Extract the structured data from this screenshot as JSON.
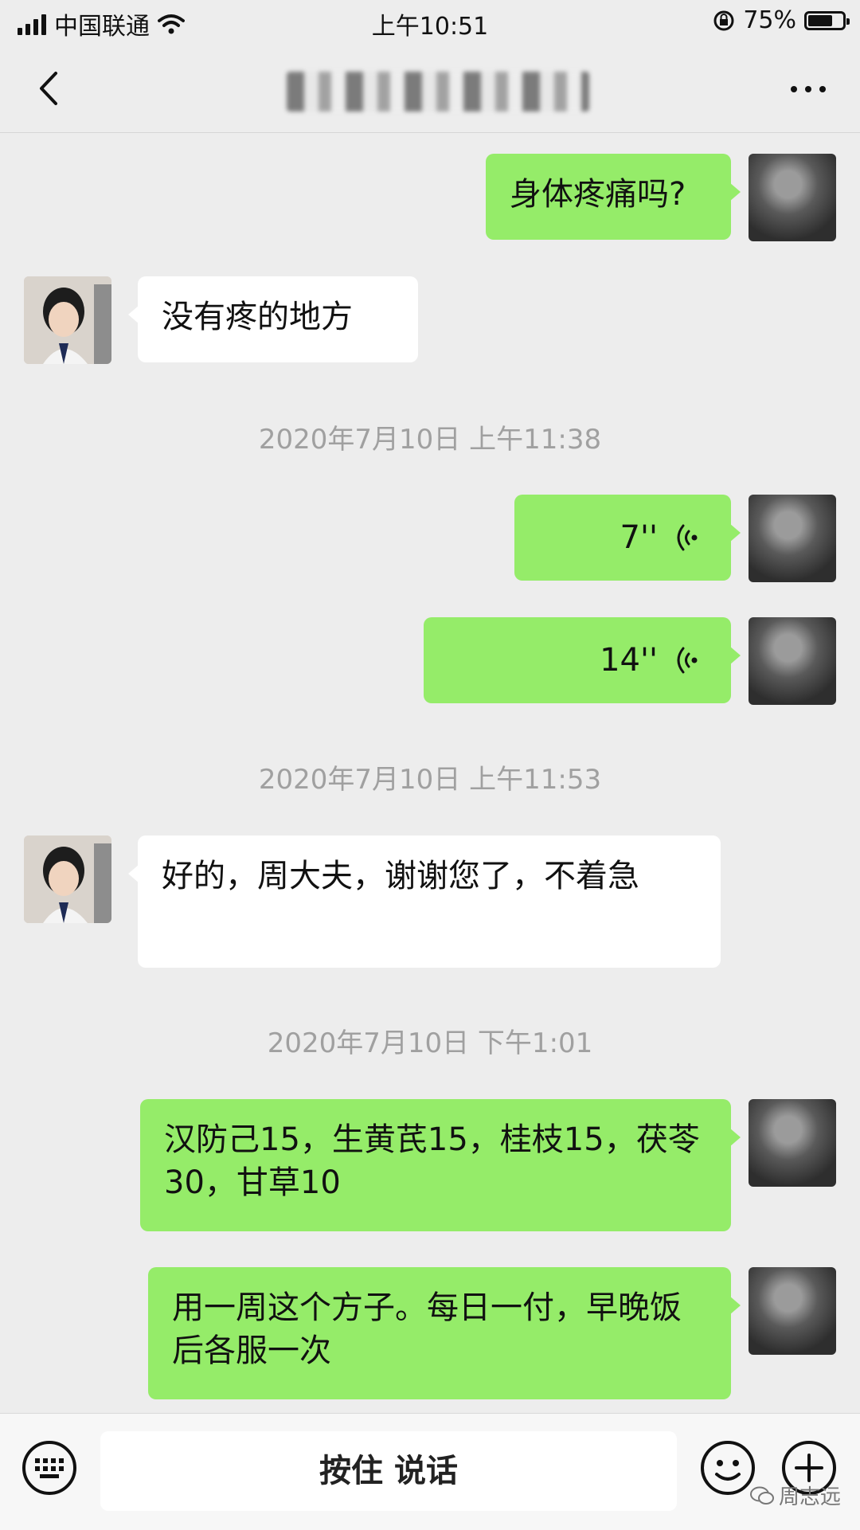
{
  "status_bar": {
    "carrier": "中国联通",
    "time": "上午10:51",
    "battery": "75%",
    "battery_level": 0.75
  },
  "nav": {
    "title": ""
  },
  "messages": [
    {
      "type": "text",
      "side": "out",
      "text": "身体疼痛吗?"
    },
    {
      "type": "text",
      "side": "in",
      "text": "没有疼的地方"
    },
    {
      "type": "timestamp",
      "text": "2020年7月10日 上午11:38"
    },
    {
      "type": "voice",
      "side": "out",
      "duration": "7''"
    },
    {
      "type": "voice",
      "side": "out",
      "duration": "14''"
    },
    {
      "type": "timestamp",
      "text": "2020年7月10日 上午11:53"
    },
    {
      "type": "text",
      "side": "in",
      "text": "好的，周大夫，谢谢您了，不着急"
    },
    {
      "type": "timestamp",
      "text": "2020年7月10日 下午1:01"
    },
    {
      "type": "text",
      "side": "out",
      "text": "汉防己15，生黄芪15，桂枝15，茯苓30，甘草10"
    },
    {
      "type": "text",
      "side": "out",
      "text": "用一周这个方子。每日一付，早晚饭后各服一次"
    }
  ],
  "input_bar": {
    "talk_label": "按住 说话"
  },
  "watermark": "周志远",
  "icons": [
    "back-icon",
    "more-icon",
    "keyboard-icon",
    "emoji-icon",
    "plus-icon",
    "voice-wave-icon",
    "wifi-icon",
    "signal-icon",
    "lock-rotation-icon",
    "battery-icon"
  ]
}
